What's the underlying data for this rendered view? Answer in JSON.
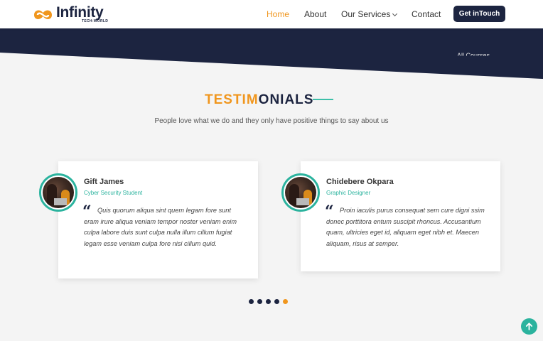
{
  "brand": {
    "name": "Infinity",
    "tagline": "TECH-WORLD",
    "colors": {
      "navy": "#1c2440",
      "orange": "#f0961e",
      "teal": "#2bb39e"
    }
  },
  "nav": {
    "items": [
      {
        "label": "Home",
        "active": true
      },
      {
        "label": "About",
        "active": false
      },
      {
        "label": "Our Services",
        "active": false,
        "icon": "chevron-down-icon"
      },
      {
        "label": "Contact",
        "active": false
      }
    ],
    "cta": "Get inTouch"
  },
  "hero": {
    "partial_text": "All Courses"
  },
  "section": {
    "title_part1": "TESTIM",
    "title_part2": "ONIALS",
    "subtitle": "People love what we do and they only have positive things to say about us"
  },
  "testimonials": [
    {
      "name": "Gift James",
      "role": "Cyber Security Student",
      "quote": "Quis quorum aliqua sint quem legam fore sunt eram irure aliqua veniam tempor noster veniam enim culpa labore duis sunt culpa nulla illum cillum fugiat legam esse veniam culpa fore nisi cillum quid."
    },
    {
      "name": "Chidebere Okpara",
      "role": "Graphic Designer",
      "quote": "Proin iaculis purus consequat sem cure digni ssim donec porttitora entum suscipit rhoncus. Accusantium quam, ultricies eget id, aliquam eget nibh et. Maecen aliquam, risus at semper."
    }
  ],
  "carousel": {
    "total": 5,
    "active": 5
  }
}
